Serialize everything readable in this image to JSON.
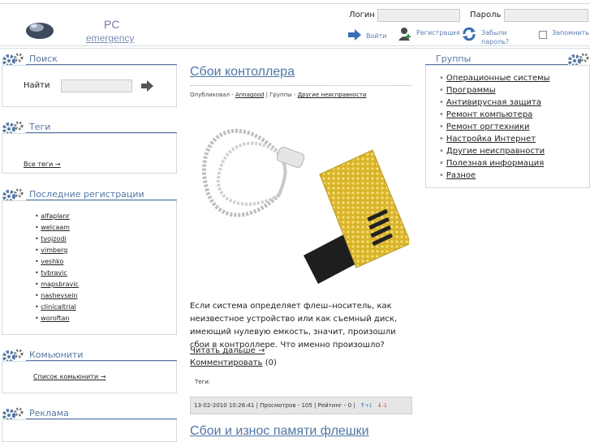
{
  "header": {
    "logo_line1": "PC",
    "logo_line2": "emergency",
    "login_label": "Логин",
    "password_label": "Пароль",
    "login_button": "Войти",
    "register_link": "Регистрация",
    "forgot_link": "Забыли пароль?",
    "remember_label": "Запомнить"
  },
  "sidebar": {
    "search": {
      "title": "Поиск",
      "find_label": "Найти"
    },
    "tags": {
      "title": "Теги",
      "all_tags_link": "Все теги →"
    },
    "registrations": {
      "title": "Последние регистрации",
      "users": [
        "alfaplanr",
        "welcaam",
        "tvojzodi",
        "vimberg",
        "veshko",
        "tvbravic",
        "mapsbravic",
        "nashevsein",
        "clinicaltrial",
        "woroftan"
      ]
    },
    "communities": {
      "title": "Комьюнити",
      "list_link": "Список комьюнити →"
    },
    "ads": {
      "title": "Реклама"
    }
  },
  "groups": {
    "title": "Группы",
    "items": [
      "Операционные системы",
      "Программы",
      "Антивирусная защита",
      "Ремонт компьютера",
      "Ремонт оргтехники",
      "Настройка Интернет",
      "Другие неисправности",
      "Полезная информация",
      "Разное"
    ]
  },
  "post": {
    "title": "Сбои контоллера",
    "meta_prefix": "Опубликовал - ",
    "author": "Annagood",
    "meta_groups": " | Группы - ",
    "group": "Другие неисправности",
    "body": "Если система определяет флеш–носитель, как неизвестное устройство или как съемный диск, имеющий нулевую емкость, значит, произошли сбои в контроллере. Что именно произошло?",
    "read_more": "Читать дальше →",
    "comment_link": "Комментировать",
    "comment_count": " (0)",
    "tags_label": "Теги:",
    "stats": "13-02-2010 10:26:41 | Просмотров - 105 | Рейтинг - 0 |",
    "vote_up": "+1",
    "vote_down": "-1"
  },
  "next_post": {
    "title": "Сбои и износ памяти флешки"
  }
}
